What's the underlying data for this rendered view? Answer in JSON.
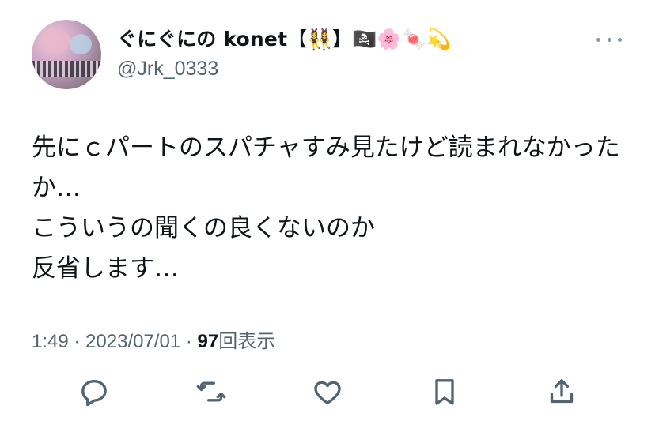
{
  "author": {
    "display_name": "ぐにぐにの konet",
    "name_emojis": "【👯‍♀️】🏴‍☠️🌸🍬💫",
    "handle": "@Jrk_0333"
  },
  "tweet": {
    "text": "先にｃパートのスパチャすみ見たけど読まれなかったか…\nこういうの聞くの良くないのか\n反省します…",
    "time": "1:49",
    "date": "2023/07/01",
    "views_count": "97",
    "views_label": "回表示"
  },
  "actions": {
    "reply": "reply-icon",
    "retweet": "retweet-icon",
    "like": "heart-icon",
    "bookmark": "bookmark-icon",
    "share": "share-icon"
  },
  "colors": {
    "text": "#0f1419",
    "secondary": "#536471",
    "background": "#ffffff"
  }
}
